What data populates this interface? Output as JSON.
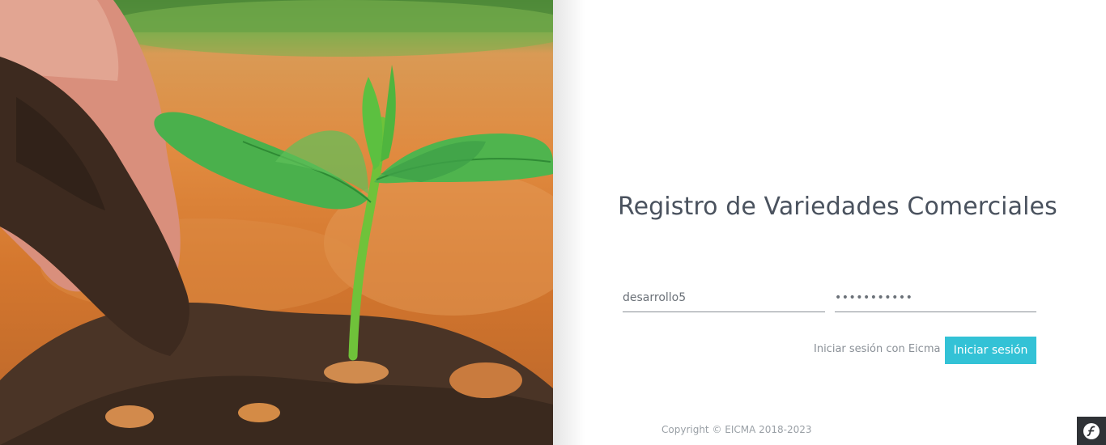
{
  "login": {
    "title": "Registro de Variedades Comerciales",
    "username_value": "desarrollo5",
    "password_value": "•••••••••••",
    "eicma_link_label": "Iniciar sesión con Eicma",
    "submit_label": "Iniciar sesión"
  },
  "footer": {
    "copyright": "Copyright © EICMA 2018-2023"
  },
  "toolbar": {
    "icon": "symfony-logo-icon",
    "bg_color": "#2f3236"
  },
  "colors": {
    "accent": "#33c2d6",
    "title": "#4a525e",
    "muted_text": "#8a9097"
  }
}
